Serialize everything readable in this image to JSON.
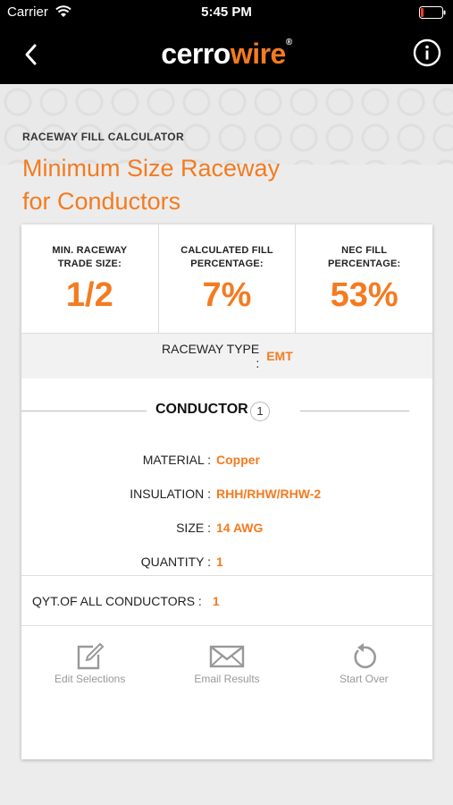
{
  "status_bar": {
    "carrier": "Carrier",
    "time": "5:45 PM"
  },
  "nav": {
    "logo_prefix": "cerro",
    "logo_suffix": "wire",
    "logo_mark": "®"
  },
  "header": {
    "kicker": "RACEWAY FILL CALCULATOR",
    "title_line1": "Minimum Size Raceway",
    "title_line2": "for Conductors"
  },
  "stats": [
    {
      "label_line1": "MIN. RACEWAY",
      "label_line2": "TRADE SIZE:",
      "value": "1/2"
    },
    {
      "label_line1": "CALCULATED FILL",
      "label_line2": "PERCENTAGE:",
      "value": "7%"
    },
    {
      "label_line1": "NEC FILL",
      "label_line2": "PERCENTAGE:",
      "value": "53%"
    }
  ],
  "raceway": {
    "label": "RACEWAY TYPE :",
    "value": "EMT"
  },
  "conductor": {
    "title": "CONDUCTOR",
    "number": "1",
    "props": [
      {
        "label": "MATERIAL :",
        "value": "Copper"
      },
      {
        "label": "INSULATION :",
        "value": "RHH/RHW/RHW-2"
      },
      {
        "label": "SIZE :",
        "value": "14 AWG"
      },
      {
        "label": "QUANTITY :",
        "value": "1"
      }
    ]
  },
  "total": {
    "label": "QYT.OF ALL CONDUCTORS :",
    "value": "1"
  },
  "actions": [
    {
      "label": "Edit Selections",
      "icon": "edit-icon"
    },
    {
      "label": "Email Results",
      "icon": "envelope-icon"
    },
    {
      "label": "Start Over",
      "icon": "restart-icon"
    }
  ],
  "colors": {
    "accent": "#f47b20",
    "bar": "#000000"
  }
}
